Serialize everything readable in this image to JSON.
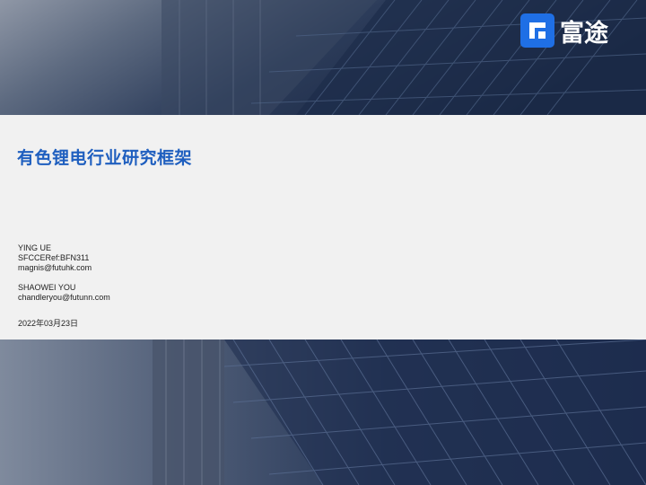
{
  "logo": {
    "brand": "富途",
    "accent": "#1f6fe5"
  },
  "title": "有色锂电行业研究框架",
  "author1": {
    "name": "YING UE",
    "ref": "SFCCERef:BFN311",
    "email": "magnis@futuhk.com"
  },
  "author2": {
    "name": "SHAOWEI YOU",
    "email": "chandleryou@futunn.com"
  },
  "date": "2022年03月23日",
  "colors": {
    "title": "#1f5fbf",
    "band": "#f1f1f1",
    "background": "#1b2a44"
  }
}
